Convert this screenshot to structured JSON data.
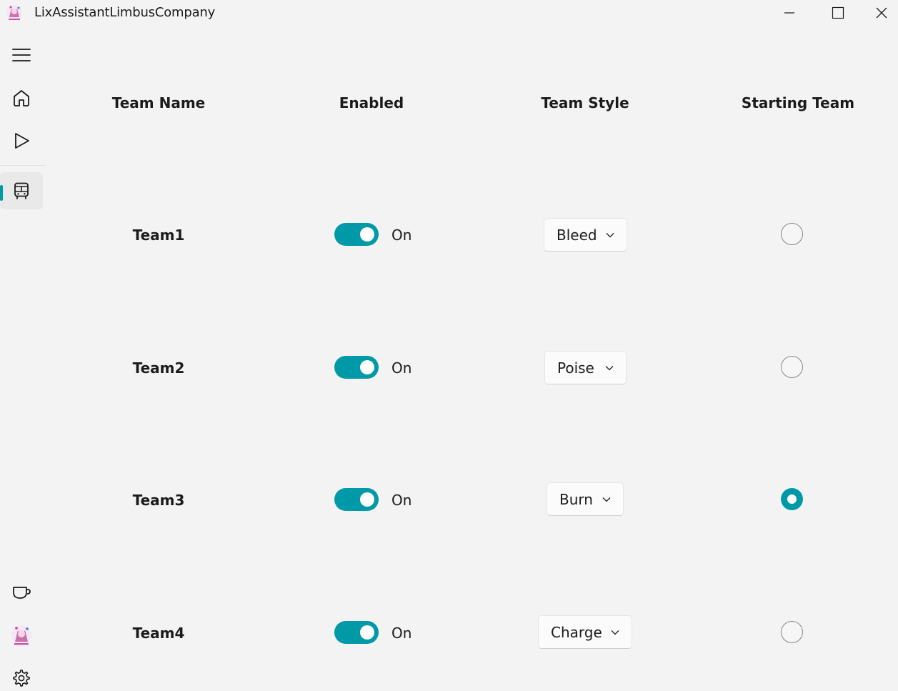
{
  "app": {
    "title": "LixAssistantLimbusCompany",
    "accent": "#0099a8"
  },
  "sidebar": {
    "top_items": [
      {
        "icon": "hamburger-menu-icon"
      },
      {
        "icon": "home-icon"
      },
      {
        "icon": "play-icon"
      },
      {
        "icon": "bus-icon",
        "selected": true
      }
    ],
    "bottom_items": [
      {
        "icon": "coffee-cup-icon"
      },
      {
        "icon": "avatar-icon"
      },
      {
        "icon": "gear-icon"
      }
    ]
  },
  "table": {
    "headers": [
      "Team Name",
      "Enabled",
      "Team Style",
      "Starting Team"
    ],
    "rows": [
      {
        "name": "Team1",
        "enabled": true,
        "enabled_label": "On",
        "style": "Bleed",
        "starting": false
      },
      {
        "name": "Team2",
        "enabled": true,
        "enabled_label": "On",
        "style": "Poise",
        "starting": false
      },
      {
        "name": "Team3",
        "enabled": true,
        "enabled_label": "On",
        "style": "Burn",
        "starting": true
      },
      {
        "name": "Team4",
        "enabled": true,
        "enabled_label": "On",
        "style": "Charge",
        "starting": false
      }
    ]
  }
}
